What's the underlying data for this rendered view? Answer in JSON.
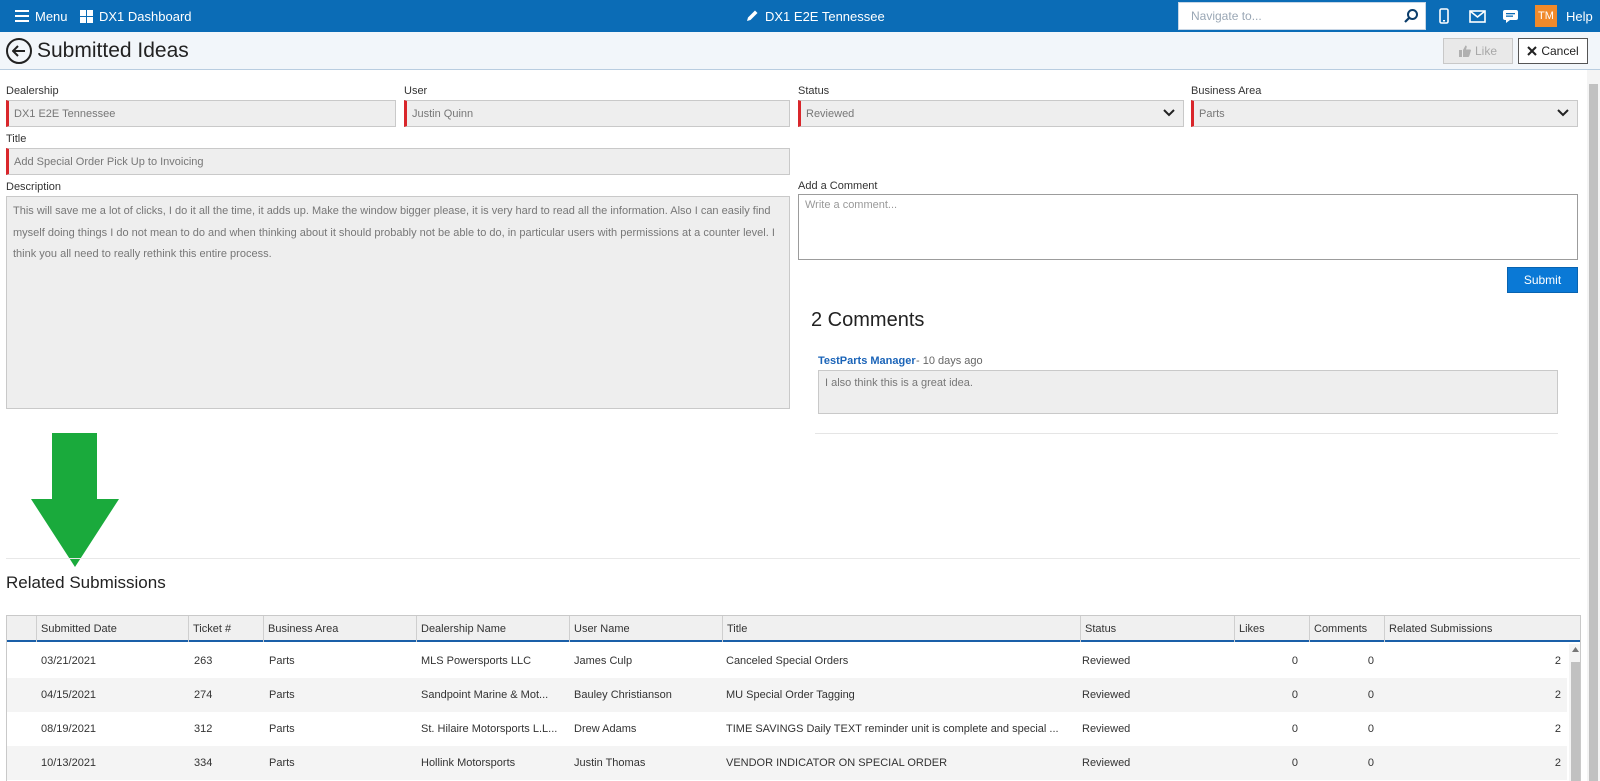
{
  "topbar": {
    "menu_label": "Menu",
    "dashboard_label": "DX1 Dashboard",
    "dealership_title": "DX1 E2E Tennessee",
    "search_placeholder": "Navigate to...",
    "avatar_initials": "TM",
    "help_label": "Help",
    "bg_color": "#0b6cb6"
  },
  "header": {
    "title": "Submitted Ideas",
    "like_label": "Like",
    "cancel_label": "Cancel"
  },
  "form": {
    "dealership_label": "Dealership",
    "dealership_value": "DX1 E2E Tennessee",
    "user_label": "User",
    "user_value": "Justin Quinn",
    "status_label": "Status",
    "status_value": "Reviewed",
    "business_area_label": "Business Area",
    "business_area_value": "Parts",
    "title_label": "Title",
    "title_value": "Add Special Order Pick Up to Invoicing",
    "description_label": "Description",
    "description_value": "This will save me a lot of clicks, I do it all the time, it adds up. Make the window bigger please, it is very hard to read all the information. Also I can easily find myself doing things I do not mean to do and when thinking about it should probably not be able to do, in particular users with permissions at a counter level. I think you all need to really rethink this entire process.",
    "add_comment_label": "Add a Comment",
    "comment_placeholder": "Write a comment...",
    "submit_label": "Submit",
    "required_color": "#d9262b"
  },
  "comments": {
    "count_label": "2 Comments",
    "items": [
      {
        "author": "TestParts Manager",
        "meta": "- 10 days ago",
        "text": "I also think this is a great idea."
      }
    ]
  },
  "related": {
    "title": "Related Submissions",
    "columns": [
      "Submitted Date",
      "Ticket #",
      "Business Area",
      "Dealership Name",
      "User Name",
      "Title",
      "Status",
      "Likes",
      "Comments",
      "Related Submissions"
    ],
    "rows": [
      {
        "date": "03/21/2021",
        "ticket": "263",
        "area": "Parts",
        "dealership": "MLS Powersports LLC",
        "user": "James Culp",
        "title": "Canceled Special Orders",
        "status": "Reviewed",
        "likes": "0",
        "comments": "0",
        "related": "2"
      },
      {
        "date": "04/15/2021",
        "ticket": "274",
        "area": "Parts",
        "dealership": "Sandpoint Marine & Mot...",
        "user": "Bauley Christianson",
        "title": "MU Special Order Tagging",
        "status": "Reviewed",
        "likes": "0",
        "comments": "0",
        "related": "2"
      },
      {
        "date": "08/19/2021",
        "ticket": "312",
        "area": "Parts",
        "dealership": "St. Hilaire Motorsports L.L...",
        "user": "Drew Adams",
        "title": "TIME SAVINGS Daily TEXT reminder unit is complete and special ...",
        "status": "Reviewed",
        "likes": "0",
        "comments": "0",
        "related": "2"
      },
      {
        "date": "10/13/2021",
        "ticket": "334",
        "area": "Parts",
        "dealership": "Hollink Motorsports",
        "user": "Justin Thomas",
        "title": "VENDOR INDICATOR ON SPECIAL ORDER",
        "status": "Reviewed",
        "likes": "0",
        "comments": "0",
        "related": "2"
      }
    ]
  },
  "annotation": {
    "arrow_color": "#1aaa3c"
  }
}
